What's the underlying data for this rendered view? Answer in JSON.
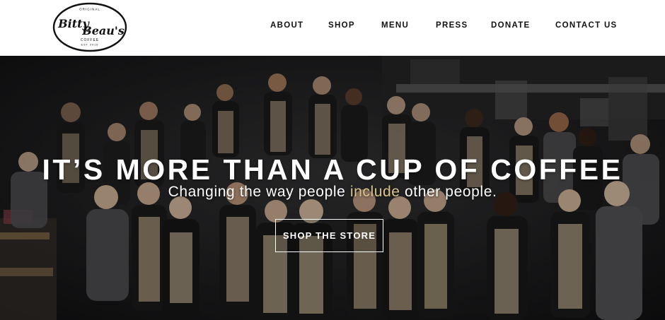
{
  "brand": {
    "top_text": "ORIGINAL",
    "name_line1": "Bitty",
    "ampersand": "&",
    "name_line2": "Beau's",
    "sub_text": "COFFEE",
    "est_text": "EST 2016"
  },
  "nav": {
    "items": [
      {
        "label": "ABOUT"
      },
      {
        "label": "SHOP"
      },
      {
        "label": "MENU"
      },
      {
        "label": "PRESS"
      },
      {
        "label": "DONATE"
      },
      {
        "label": "CONTACT US"
      }
    ]
  },
  "hero": {
    "headline": "IT’S MORE THAN A CUP OF COFFEE",
    "sub_before": "Changing the way people ",
    "sub_accent": "include",
    "sub_after": " other people.",
    "cta_label": "SHOP THE STORE"
  },
  "colors": {
    "accent": "#d9c48b",
    "hero_overlay": "#1b1b1d"
  }
}
